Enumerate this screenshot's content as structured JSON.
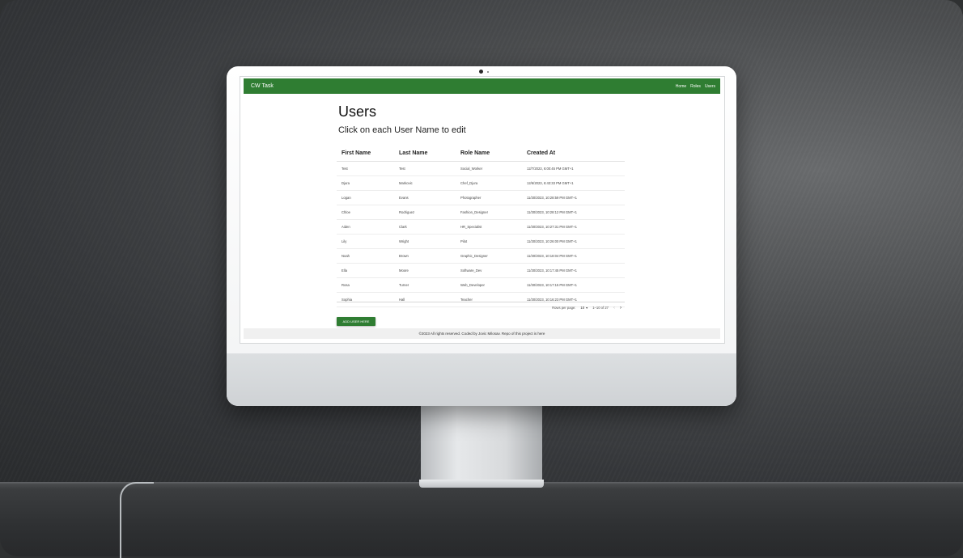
{
  "app": {
    "brand": "CW Task",
    "nav": [
      "Home",
      "Roles",
      "Users"
    ]
  },
  "page": {
    "title": "Users",
    "subtitle": "Click on each User Name to edit"
  },
  "table": {
    "headers": [
      "First Name",
      "Last Name",
      "Role Name",
      "Created At"
    ],
    "rows": [
      [
        "Test",
        "Test",
        "Social_Worker",
        "12/7/2023, 6:00:45 PM GMT+1"
      ],
      [
        "Djura",
        "Markovic",
        "Chef_Djura",
        "12/6/2023, 6:43:33 PM GMT+1"
      ],
      [
        "Logan",
        "Evans",
        "Photographer",
        "11/30/2023, 10:28:59 PM GMT+1"
      ],
      [
        "Chloe",
        "Rodriguez",
        "Fashion_Designer",
        "11/30/2023, 10:28:12 PM GMT+1"
      ],
      [
        "Aiden",
        "Clark",
        "HR_Specialist",
        "11/30/2023, 10:27:31 PM GMT+1"
      ],
      [
        "Lily",
        "Wright",
        "Pilot",
        "11/30/2023, 10:26:00 PM GMT+1"
      ],
      [
        "Noah",
        "Brown",
        "Graphic_Designer",
        "11/30/2023, 10:18:04 PM GMT+1"
      ],
      [
        "Ella",
        "Moore",
        "Software_Dev",
        "11/30/2023, 10:17:45 PM GMT+1"
      ],
      [
        "Rosa",
        "Turner",
        "Web_Developer",
        "11/30/2023, 10:17:15 PM GMT+1"
      ],
      [
        "Sophia",
        "Hall",
        "Teacher",
        "11/30/2023, 10:16:23 PM GMT+1"
      ]
    ]
  },
  "pagination": {
    "rows_per_page_label": "Rows per page:",
    "rows_per_page_value": "10",
    "range": "1–10 of 27",
    "prev_icon": "chevron-left-icon",
    "next_icon": "chevron-right-icon"
  },
  "actions": {
    "add_user": "ADD USER HERE"
  },
  "footer": {
    "text": "©2023 All rights reserved. Coded by Jovic Milosav. Repo of this project is here"
  },
  "colors": {
    "primary": "#2f7d32"
  }
}
